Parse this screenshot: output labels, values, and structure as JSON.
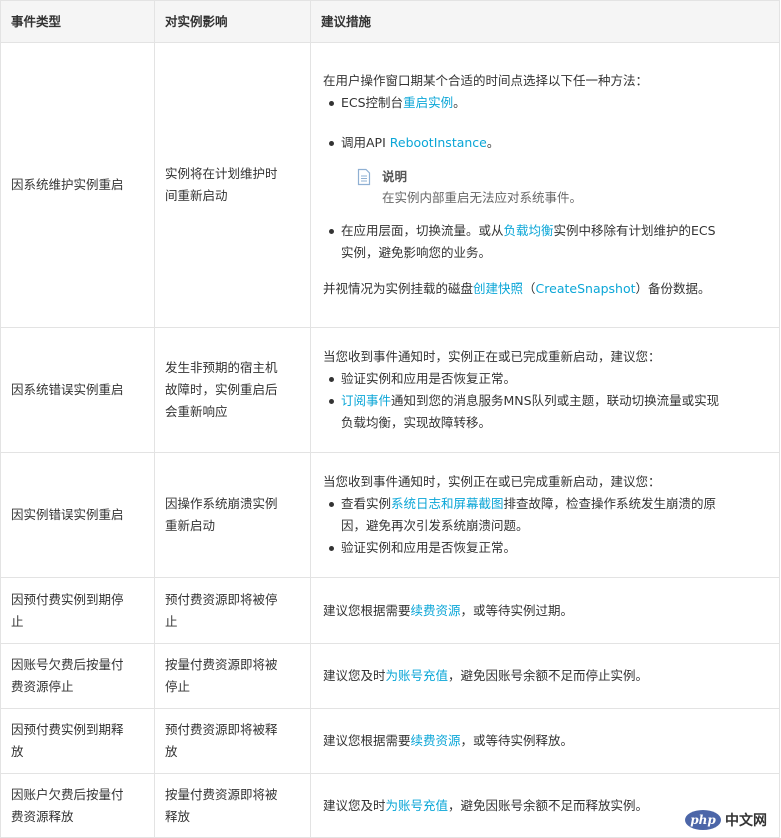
{
  "headers": [
    "事件类型",
    "对实例影响",
    "建议措施"
  ],
  "rows": [
    {
      "event": "因系统维护实例重启",
      "impact": [
        "实例将在计划维护时",
        "间重新启动"
      ],
      "intro": "在用户操作窗口期某个合适的时间点选择以下任一种方法：",
      "b1_prefix": "ECS控制台",
      "b1_link": "重启实例",
      "b1_suffix": "。",
      "b2_prefix": "调用API ",
      "b2_link": "RebootInstance",
      "b2_suffix": "。",
      "note_title": "说明",
      "note_text": "在实例内部重启无法应对系统事件。",
      "b3_prefix": "在应用层面，切换流量。或从",
      "b3_link": "负载均衡",
      "b3_suffix": "实例中移除有计划维护的ECS",
      "b3_line2": "实例，避免影响您的业务。",
      "tail_prefix": "并视情况为实例挂载的磁盘",
      "tail_link1": "创建快照",
      "tail_mid": "（",
      "tail_link2": "CreateSnapshot",
      "tail_suffix": "）备份数据。"
    },
    {
      "event": "因系统错误实例重启",
      "impact": [
        "发生非预期的宿主机",
        "故障时，实例重启后",
        "会重新响应"
      ],
      "intro": "当您收到事件通知时，实例正在或已完成重新启动，建议您：",
      "b1": "验证实例和应用是否恢复正常。",
      "b2_link": "订阅事件",
      "b2_suffix": "通知到您的消息服务MNS队列或主题，联动切换流量或实现",
      "b2_line2": "负载均衡，实现故障转移。"
    },
    {
      "event": "因实例错误实例重启",
      "impact": [
        "因操作系统崩溃实例",
        "重新启动"
      ],
      "intro": "当您收到事件通知时，实例正在或已完成重新启动，建议您：",
      "b1_prefix": "查看实例",
      "b1_link": "系统日志和屏幕截图",
      "b1_suffix": "排查故障，检查操作系统发生崩溃的原",
      "b1_line2": "因，避免再次引发系统崩溃问题。",
      "b2": "验证实例和应用是否恢复正常。"
    },
    {
      "event": [
        "因预付费实例到期停",
        "止"
      ],
      "impact": [
        "预付费资源即将被停",
        "止"
      ],
      "prefix": "建议您根据需要",
      "link": "续费资源",
      "suffix": "，或等待实例过期。"
    },
    {
      "event": [
        "因账号欠费后按量付",
        "费资源停止"
      ],
      "impact": [
        "按量付费资源即将被",
        "停止"
      ],
      "prefix": "建议您及时",
      "link": "为账号充值",
      "suffix": "，避免因账号余额不足而停止实例。"
    },
    {
      "event": [
        "因预付费实例到期释",
        "放"
      ],
      "impact": [
        "预付费资源即将被释",
        "放"
      ],
      "prefix": "建议您根据需要",
      "link": "续费资源",
      "suffix": "，或等待实例释放。"
    },
    {
      "event": [
        "因账户欠费后按量付",
        "费资源释放"
      ],
      "impact": [
        "按量付费资源即将被",
        "释放"
      ],
      "prefix": "建议您及时",
      "link": "为账号充值",
      "suffix": "，避免因账号余额不足而释放实例。"
    }
  ],
  "watermark": {
    "logo": "php",
    "site": "中文网"
  },
  "colors": {
    "link": "#0ba6d7",
    "border": "#e3e3e3",
    "header_bg": "#f5f5f5"
  }
}
